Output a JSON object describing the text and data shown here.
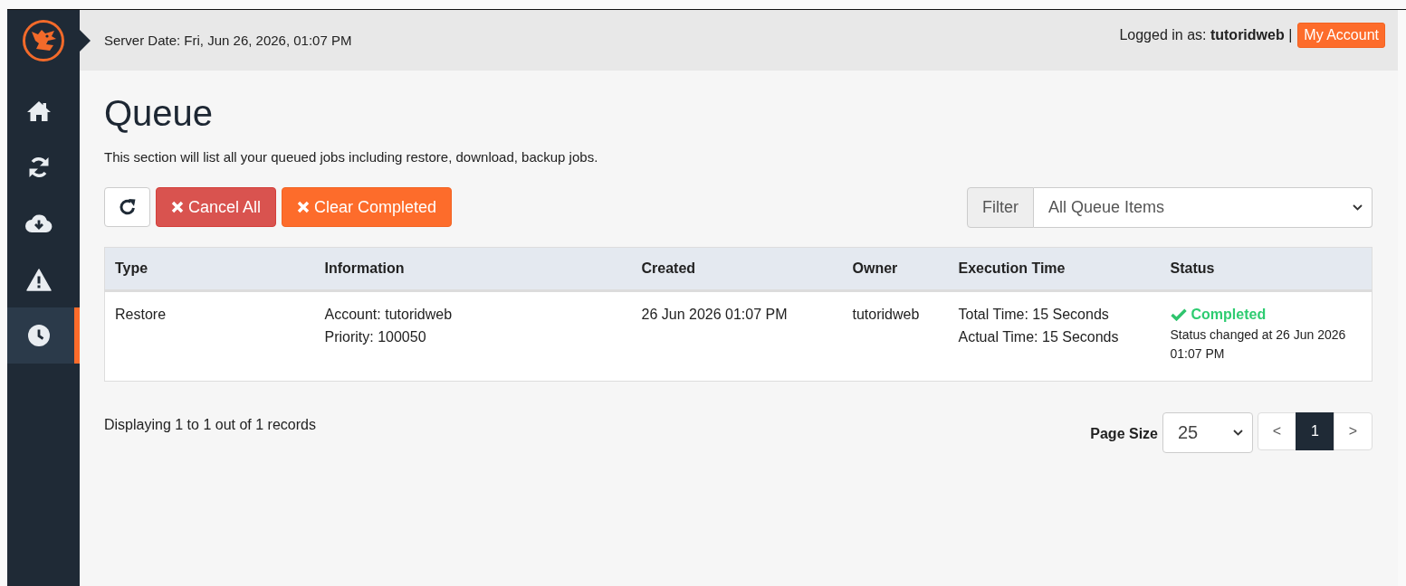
{
  "sidebar": {
    "items": [
      {
        "kind": "home",
        "selected": false
      },
      {
        "kind": "sync",
        "selected": false
      },
      {
        "kind": "download",
        "selected": false
      },
      {
        "kind": "warning",
        "selected": false
      },
      {
        "kind": "clock",
        "selected": true
      }
    ]
  },
  "header": {
    "server_date": "Server Date: Fri, Jun 26, 2026, 01:07 PM",
    "login_text": "Logged in as: **tutoridweb** |",
    "account_button": "My Account"
  },
  "page": {
    "title": "Queue",
    "description": "This section will list all your queued jobs including restore, download, backup jobs."
  },
  "toolbar": {
    "buttons": [
      {
        "kind": "refresh"
      },
      {
        "kind": "danger",
        "label": "Cancel All"
      },
      {
        "kind": "warning",
        "label": "Clear Completed"
      }
    ],
    "filter": {
      "label": "Filter",
      "value": "All Queue Items"
    }
  },
  "table": {
    "columns": [
      "Type",
      "Information",
      "Created",
      "Owner",
      "Execution Time",
      "Status"
    ],
    "rows": [
      {
        "type": "Restore",
        "information": [
          "Account: tutoridweb",
          "Priority: 100050"
        ],
        "created": "26 Jun 2026 01:07 PM",
        "owner": "tutoridweb",
        "execution_time": [
          "Total Time: 15 Seconds",
          "Actual Time: 15 Seconds"
        ],
        "status": {
          "kind": "completed",
          "label": "Completed",
          "note": "Status changed at 26 Jun 2026 01:07 PM"
        }
      }
    ]
  },
  "footer": {
    "summary": "Displaying 1 to 1 out of 1 records",
    "page_size_label": "Page Size",
    "page_size": "25",
    "pagination": [
      {
        "label": "<",
        "selected": false
      },
      {
        "label": "1",
        "selected": true
      },
      {
        "label": ">",
        "selected": false
      }
    ]
  }
}
